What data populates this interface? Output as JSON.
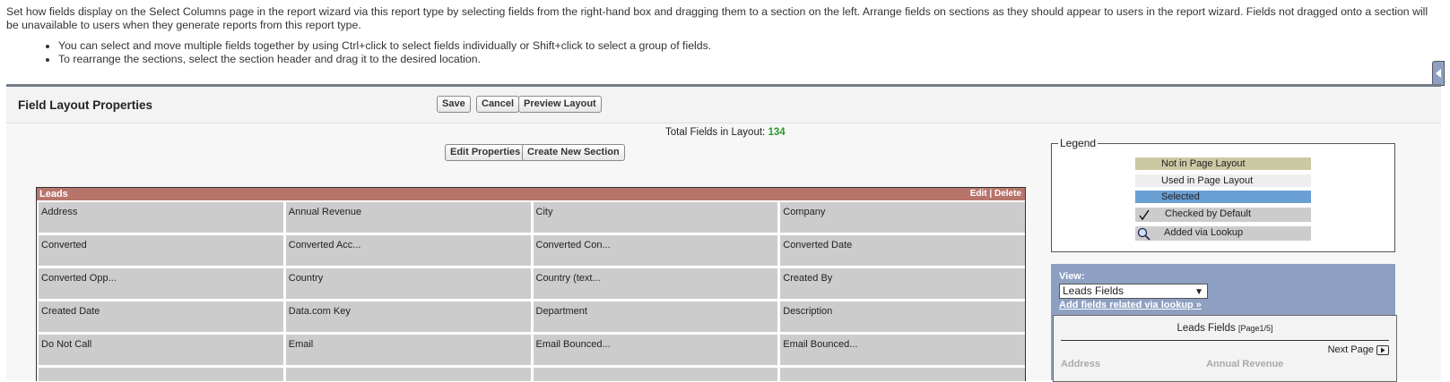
{
  "intro": {
    "text": "Set how fields display on the Select Columns page in the report wizard via this report type by selecting fields from the right-hand box and dragging them to a section on the left. Arrange fields on sections as they should appear to users in the report wizard. Fields not dragged onto a section will be unavailable to users when they generate reports from this report type.",
    "tips": [
      "You can select and move multiple fields together by using Ctrl+click to select fields individually or Shift+click to select a group of fields.",
      "To rearrange the sections, select the section header and drag it to the desired location."
    ]
  },
  "header": {
    "title": "Field Layout Properties",
    "save": "Save",
    "cancel": "Cancel",
    "preview": "Preview Layout"
  },
  "total": {
    "label": "Total Fields in Layout:",
    "count": "134"
  },
  "actions": {
    "edit_properties": "Edit Properties",
    "create_section": "Create New Section"
  },
  "section": {
    "name": "Leads",
    "edit": "Edit",
    "separator": "|",
    "delete": "Delete",
    "fields": [
      "Address",
      "Annual Revenue",
      "City",
      "Company",
      "Converted",
      "Converted Acc...",
      "Converted Con...",
      "Converted Date",
      "Converted Opp...",
      "Country",
      "Country (text...",
      "Created By",
      "Created Date",
      "Data.com Key",
      "Department",
      "Description",
      "Do Not Call",
      "Email",
      "Email Bounced...",
      "Email Bounced...",
      "",
      "",
      "",
      ""
    ]
  },
  "legend": {
    "title": "Legend",
    "items": [
      {
        "label": "Not in Page Layout",
        "color": "#cbc9a4"
      },
      {
        "label": "Used in Page Layout",
        "color": "#eeeeee"
      },
      {
        "label": "Selected",
        "color": "#6a9fd4"
      },
      {
        "label": "Checked by Default",
        "color": "#cccccc",
        "icon": "checkmark-icon"
      },
      {
        "label": "Added via Lookup",
        "color": "#cccccc",
        "icon": "magnifier-icon"
      }
    ]
  },
  "view": {
    "label": "View:",
    "selected": "Leads Fields",
    "lookup_link": "Add fields related via lookup »"
  },
  "field_list": {
    "title": "Leads Fields",
    "page": "[Page1/5]",
    "next": "Next Page",
    "visible_fields": [
      "Address",
      "Annual Revenue"
    ]
  },
  "colors": {
    "section_header": "#b7746b",
    "panel_border": "#737b86",
    "view_bg": "#8ea0c2",
    "total_count": "#2a9a2a"
  }
}
